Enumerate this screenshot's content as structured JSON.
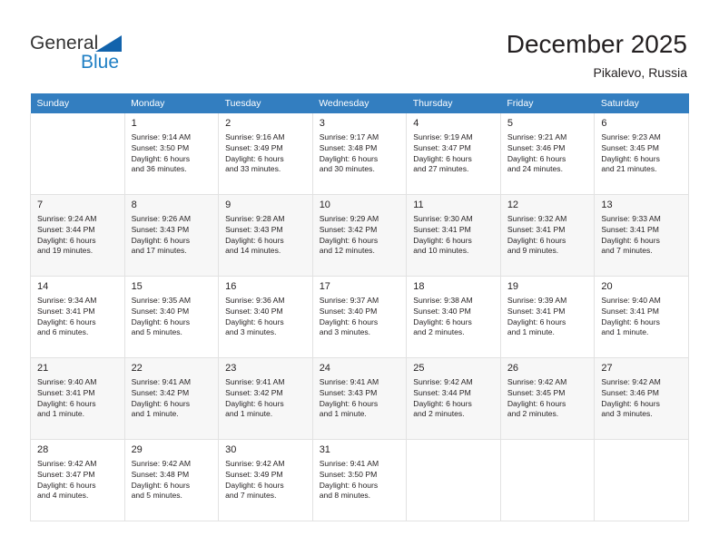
{
  "brand": {
    "name_top": "General",
    "name_bottom": "Blue",
    "triangle_color": "#1263ac",
    "blue_text_color": "#1f7fc4"
  },
  "header": {
    "title": "December 2025",
    "subtitle": "Pikalevo, Russia"
  },
  "theme": {
    "header_row_bg": "#337ec0",
    "header_row_text": "#ffffff",
    "alt_row_bg": "#f7f7f7",
    "cell_border": "#e2e2e2",
    "text": "#231f20"
  },
  "weekday_headers": [
    "Sunday",
    "Monday",
    "Tuesday",
    "Wednesday",
    "Thursday",
    "Friday",
    "Saturday"
  ],
  "weeks": [
    [
      {
        "empty": true
      },
      {
        "day": "1",
        "sunrise": "Sunrise: 9:14 AM",
        "sunset": "Sunset: 3:50 PM",
        "daylight1": "Daylight: 6 hours",
        "daylight2": "and 36 minutes."
      },
      {
        "day": "2",
        "sunrise": "Sunrise: 9:16 AM",
        "sunset": "Sunset: 3:49 PM",
        "daylight1": "Daylight: 6 hours",
        "daylight2": "and 33 minutes."
      },
      {
        "day": "3",
        "sunrise": "Sunrise: 9:17 AM",
        "sunset": "Sunset: 3:48 PM",
        "daylight1": "Daylight: 6 hours",
        "daylight2": "and 30 minutes."
      },
      {
        "day": "4",
        "sunrise": "Sunrise: 9:19 AM",
        "sunset": "Sunset: 3:47 PM",
        "daylight1": "Daylight: 6 hours",
        "daylight2": "and 27 minutes."
      },
      {
        "day": "5",
        "sunrise": "Sunrise: 9:21 AM",
        "sunset": "Sunset: 3:46 PM",
        "daylight1": "Daylight: 6 hours",
        "daylight2": "and 24 minutes."
      },
      {
        "day": "6",
        "sunrise": "Sunrise: 9:23 AM",
        "sunset": "Sunset: 3:45 PM",
        "daylight1": "Daylight: 6 hours",
        "daylight2": "and 21 minutes."
      }
    ],
    [
      {
        "day": "7",
        "sunrise": "Sunrise: 9:24 AM",
        "sunset": "Sunset: 3:44 PM",
        "daylight1": "Daylight: 6 hours",
        "daylight2": "and 19 minutes."
      },
      {
        "day": "8",
        "sunrise": "Sunrise: 9:26 AM",
        "sunset": "Sunset: 3:43 PM",
        "daylight1": "Daylight: 6 hours",
        "daylight2": "and 17 minutes."
      },
      {
        "day": "9",
        "sunrise": "Sunrise: 9:28 AM",
        "sunset": "Sunset: 3:43 PM",
        "daylight1": "Daylight: 6 hours",
        "daylight2": "and 14 minutes."
      },
      {
        "day": "10",
        "sunrise": "Sunrise: 9:29 AM",
        "sunset": "Sunset: 3:42 PM",
        "daylight1": "Daylight: 6 hours",
        "daylight2": "and 12 minutes."
      },
      {
        "day": "11",
        "sunrise": "Sunrise: 9:30 AM",
        "sunset": "Sunset: 3:41 PM",
        "daylight1": "Daylight: 6 hours",
        "daylight2": "and 10 minutes."
      },
      {
        "day": "12",
        "sunrise": "Sunrise: 9:32 AM",
        "sunset": "Sunset: 3:41 PM",
        "daylight1": "Daylight: 6 hours",
        "daylight2": "and 9 minutes."
      },
      {
        "day": "13",
        "sunrise": "Sunrise: 9:33 AM",
        "sunset": "Sunset: 3:41 PM",
        "daylight1": "Daylight: 6 hours",
        "daylight2": "and 7 minutes."
      }
    ],
    [
      {
        "day": "14",
        "sunrise": "Sunrise: 9:34 AM",
        "sunset": "Sunset: 3:41 PM",
        "daylight1": "Daylight: 6 hours",
        "daylight2": "and 6 minutes."
      },
      {
        "day": "15",
        "sunrise": "Sunrise: 9:35 AM",
        "sunset": "Sunset: 3:40 PM",
        "daylight1": "Daylight: 6 hours",
        "daylight2": "and 5 minutes."
      },
      {
        "day": "16",
        "sunrise": "Sunrise: 9:36 AM",
        "sunset": "Sunset: 3:40 PM",
        "daylight1": "Daylight: 6 hours",
        "daylight2": "and 3 minutes."
      },
      {
        "day": "17",
        "sunrise": "Sunrise: 9:37 AM",
        "sunset": "Sunset: 3:40 PM",
        "daylight1": "Daylight: 6 hours",
        "daylight2": "and 3 minutes."
      },
      {
        "day": "18",
        "sunrise": "Sunrise: 9:38 AM",
        "sunset": "Sunset: 3:40 PM",
        "daylight1": "Daylight: 6 hours",
        "daylight2": "and 2 minutes."
      },
      {
        "day": "19",
        "sunrise": "Sunrise: 9:39 AM",
        "sunset": "Sunset: 3:41 PM",
        "daylight1": "Daylight: 6 hours",
        "daylight2": "and 1 minute."
      },
      {
        "day": "20",
        "sunrise": "Sunrise: 9:40 AM",
        "sunset": "Sunset: 3:41 PM",
        "daylight1": "Daylight: 6 hours",
        "daylight2": "and 1 minute."
      }
    ],
    [
      {
        "day": "21",
        "sunrise": "Sunrise: 9:40 AM",
        "sunset": "Sunset: 3:41 PM",
        "daylight1": "Daylight: 6 hours",
        "daylight2": "and 1 minute."
      },
      {
        "day": "22",
        "sunrise": "Sunrise: 9:41 AM",
        "sunset": "Sunset: 3:42 PM",
        "daylight1": "Daylight: 6 hours",
        "daylight2": "and 1 minute."
      },
      {
        "day": "23",
        "sunrise": "Sunrise: 9:41 AM",
        "sunset": "Sunset: 3:42 PM",
        "daylight1": "Daylight: 6 hours",
        "daylight2": "and 1 minute."
      },
      {
        "day": "24",
        "sunrise": "Sunrise: 9:41 AM",
        "sunset": "Sunset: 3:43 PM",
        "daylight1": "Daylight: 6 hours",
        "daylight2": "and 1 minute."
      },
      {
        "day": "25",
        "sunrise": "Sunrise: 9:42 AM",
        "sunset": "Sunset: 3:44 PM",
        "daylight1": "Daylight: 6 hours",
        "daylight2": "and 2 minutes."
      },
      {
        "day": "26",
        "sunrise": "Sunrise: 9:42 AM",
        "sunset": "Sunset: 3:45 PM",
        "daylight1": "Daylight: 6 hours",
        "daylight2": "and 2 minutes."
      },
      {
        "day": "27",
        "sunrise": "Sunrise: 9:42 AM",
        "sunset": "Sunset: 3:46 PM",
        "daylight1": "Daylight: 6 hours",
        "daylight2": "and 3 minutes."
      }
    ],
    [
      {
        "day": "28",
        "sunrise": "Sunrise: 9:42 AM",
        "sunset": "Sunset: 3:47 PM",
        "daylight1": "Daylight: 6 hours",
        "daylight2": "and 4 minutes."
      },
      {
        "day": "29",
        "sunrise": "Sunrise: 9:42 AM",
        "sunset": "Sunset: 3:48 PM",
        "daylight1": "Daylight: 6 hours",
        "daylight2": "and 5 minutes."
      },
      {
        "day": "30",
        "sunrise": "Sunrise: 9:42 AM",
        "sunset": "Sunset: 3:49 PM",
        "daylight1": "Daylight: 6 hours",
        "daylight2": "and 7 minutes."
      },
      {
        "day": "31",
        "sunrise": "Sunrise: 9:41 AM",
        "sunset": "Sunset: 3:50 PM",
        "daylight1": "Daylight: 6 hours",
        "daylight2": "and 8 minutes."
      },
      {
        "empty": true
      },
      {
        "empty": true
      },
      {
        "empty": true
      }
    ]
  ]
}
